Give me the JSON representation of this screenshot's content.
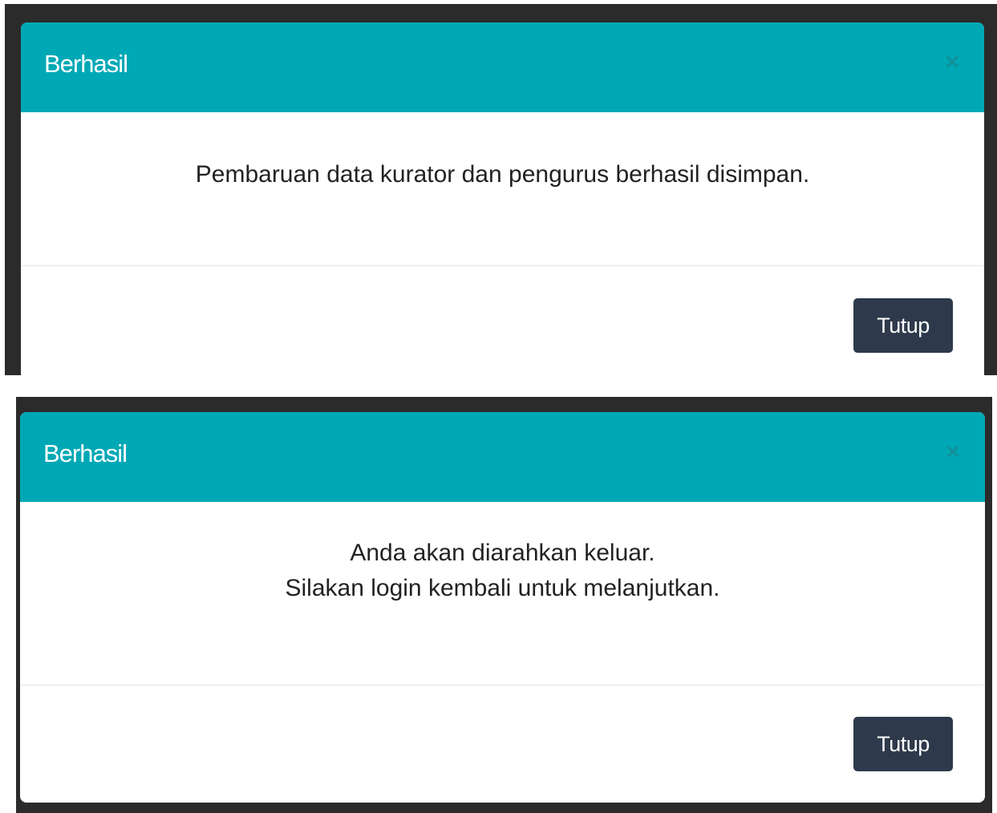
{
  "dialogs": [
    {
      "title": "Berhasil",
      "close_icon": "×",
      "message_lines": [
        "Pembaruan data kurator dan pengurus berhasil disimpan."
      ],
      "button_label": "Tutup"
    },
    {
      "title": "Berhasil",
      "close_icon": "×",
      "message_lines": [
        "Anda akan diarahkan keluar.",
        "Silakan login kembali untuk melanjutkan."
      ],
      "button_label": "Tutup"
    }
  ],
  "colors": {
    "header": "#00a8b5",
    "button": "#2e3a4b",
    "backdrop": "#2b2b2b"
  }
}
